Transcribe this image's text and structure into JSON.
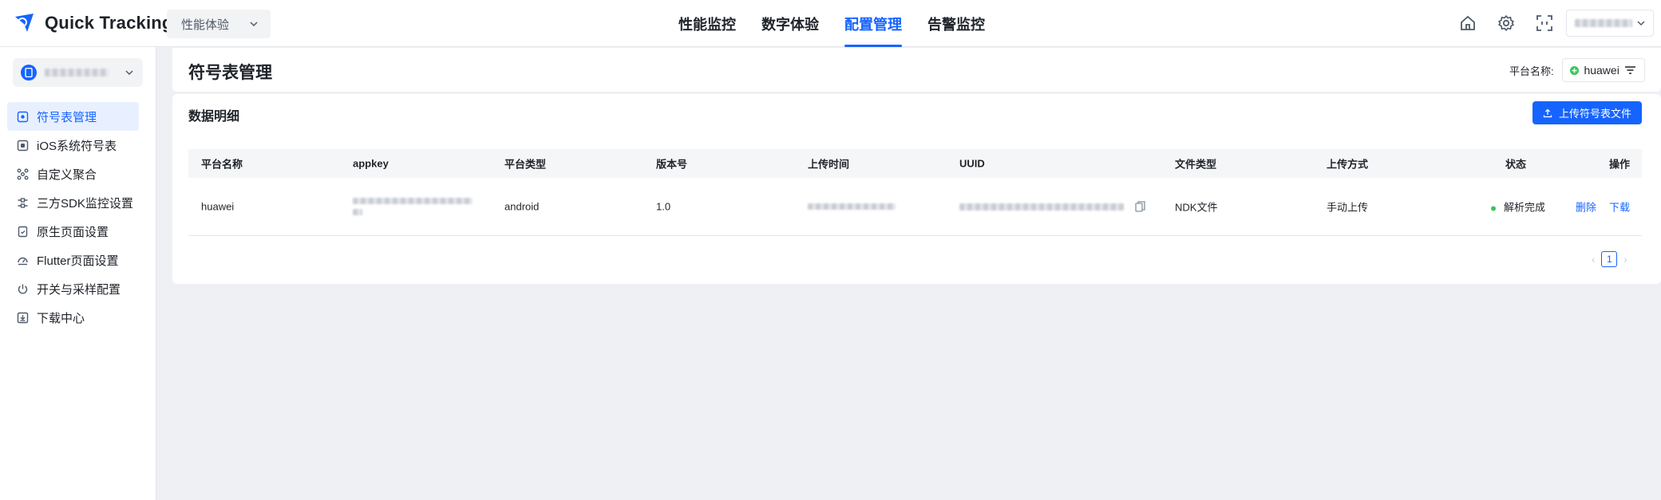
{
  "app": {
    "name": "Quick Tracking"
  },
  "product_select": {
    "value": "性能体验"
  },
  "nav": [
    {
      "label": "性能监控"
    },
    {
      "label": "数字体验"
    },
    {
      "label": "配置管理"
    },
    {
      "label": "告警监控"
    }
  ],
  "nav_active": "配置管理",
  "top_icons": [
    "home-icon",
    "gear-icon",
    "scan-icon"
  ],
  "sidebar": {
    "items": [
      {
        "label": "符号表管理",
        "icon": "symbol-table-icon"
      },
      {
        "label": "iOS系统符号表",
        "icon": "ios-icon"
      },
      {
        "label": "自定义聚合",
        "icon": "aggregate-icon"
      },
      {
        "label": "三方SDK监控设置",
        "icon": "sdk-icon"
      },
      {
        "label": "原生页面设置",
        "icon": "native-page-icon"
      },
      {
        "label": "Flutter页面设置",
        "icon": "flutter-icon"
      },
      {
        "label": "开关与采样配置",
        "icon": "power-icon"
      },
      {
        "label": "下载中心",
        "icon": "download-icon"
      }
    ]
  },
  "header": {
    "title": "符号表管理",
    "platform_label": "平台名称:",
    "platform_value": "huawei"
  },
  "data_section": {
    "title": "数据明细",
    "upload_label": "上传符号表文件"
  },
  "table": {
    "columns": [
      "平台名称",
      "appkey",
      "平台类型",
      "版本号",
      "上传时间",
      "UUID",
      "文件类型",
      "上传方式",
      "状态",
      "操作"
    ],
    "rows": [
      {
        "platform": "huawei",
        "platform_type": "android",
        "version": "1.0",
        "file_type": "NDK文件",
        "upload_method": "手动上传",
        "status": "解析完成",
        "action_delete": "删除",
        "action_download": "下载"
      }
    ]
  },
  "pagination": {
    "current": "1",
    "prev": "‹",
    "next": "›"
  },
  "colors": {
    "accent": "#1664ff",
    "success": "#34c759",
    "background": "#eef0f4"
  }
}
